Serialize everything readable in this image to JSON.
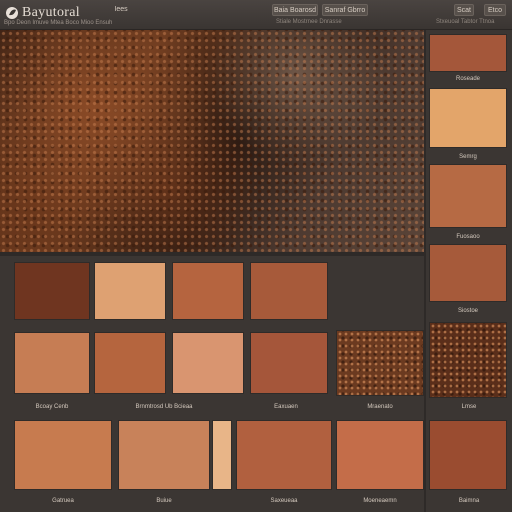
{
  "app": {
    "title": "Bayutoral",
    "logo_icon": "leaf-icon"
  },
  "topbar": {
    "subnav": "Bpo Deon Imuve Mtea  Boco  Mioo  Ensuh",
    "nav_item": "Iees",
    "buttons": [
      "Baia Boarosd",
      "Sanraf Gbrro",
      "Scat",
      "Etco"
    ],
    "subtexts": [
      "Stiale Mostrnee Dnrasse",
      "Stxeuoal Tabtor Ttnoa"
    ]
  },
  "right_panel": {
    "swatches": [
      {
        "color": "#a4573a",
        "label": "Roseade"
      },
      {
        "color": "#e3a56a",
        "label": "Semrg"
      },
      {
        "color": "#b66a44",
        "label": "Fuosaoo"
      },
      {
        "color": "#a65a3a",
        "label": "Siostoe"
      },
      {
        "color": "#5a2e1a",
        "label": "",
        "textured": true
      },
      {
        "color": "#9a4c30",
        "label": ""
      },
      {
        "color": "#7f3c22",
        "label": ""
      }
    ]
  },
  "grid": {
    "row1": [
      "#6f3520",
      "#dea172",
      "#b5643f",
      "#a75a3a"
    ],
    "row2": [
      {
        "color": "#c67d54",
        "label": ""
      },
      {
        "color": "#b5653e",
        "label": ""
      },
      {
        "color": "#d99570",
        "label": ""
      },
      {
        "color": "#a5563a",
        "label": ""
      },
      {
        "color": "#6b3a20",
        "label": "",
        "textured": true
      }
    ],
    "row2_labels": [
      "Bcoay Cenb",
      "Brnmtrosd Ub Bcieaa",
      "Eaxuaen",
      "Mraenato",
      "Lmse"
    ],
    "row3": [
      {
        "color": "#c77b4f",
        "label": "Gatruea"
      },
      {
        "color": "#c8825a",
        "label": "Buiue"
      },
      {
        "color": "#e8b588",
        "label": ""
      },
      {
        "color": "#b1603f",
        "label": "Saxeueaa"
      },
      {
        "color": "#c46d49",
        "label": "Moeneaemn"
      },
      {
        "color": "#9e4e35",
        "label": "Baimna"
      }
    ]
  }
}
